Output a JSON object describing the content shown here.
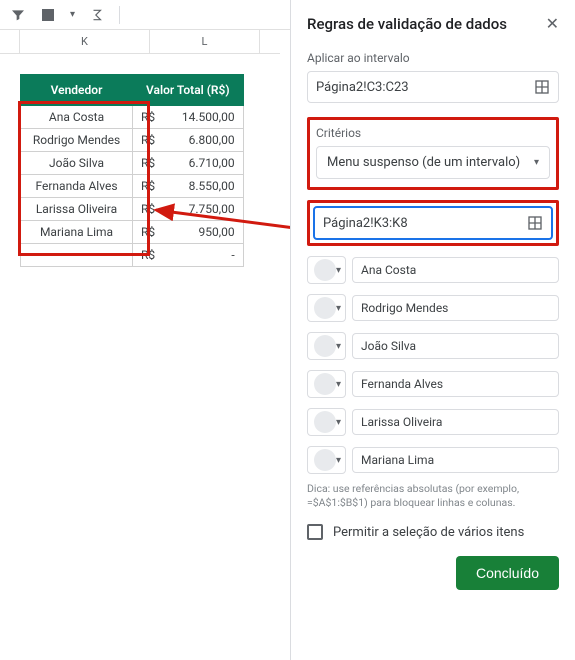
{
  "toolbar": {
    "col_k": "K",
    "col_l": "L"
  },
  "table": {
    "headers": {
      "vendedor": "Vendedor",
      "valor": "Valor Total (R$)"
    },
    "rows": [
      {
        "name": "Ana Costa",
        "curr": "R$",
        "val": "14.500,00"
      },
      {
        "name": "Rodrigo Mendes",
        "curr": "R$",
        "val": "6.800,00"
      },
      {
        "name": "João Silva",
        "curr": "R$",
        "val": "6.710,00"
      },
      {
        "name": "Fernanda Alves",
        "curr": "R$",
        "val": "8.550,00"
      },
      {
        "name": "Larissa Oliveira",
        "curr": "R$",
        "val": "7.750,00"
      },
      {
        "name": "Mariana Lima",
        "curr": "R$",
        "val": "950,00"
      }
    ],
    "empty": {
      "curr": "R$",
      "val": "-"
    }
  },
  "panel": {
    "title": "Regras de validação de dados",
    "apply_label": "Aplicar ao intervalo",
    "apply_range": "Página2!C3:C23",
    "criteria_label": "Critérios",
    "criteria_type": "Menu suspenso (de um intervalo)",
    "source_range": "Página2!K3:K8",
    "options": [
      "Ana Costa",
      "Rodrigo Mendes",
      "João Silva",
      "Fernanda Alves",
      "Larissa Oliveira",
      "Mariana Lima"
    ],
    "hint": "Dica: use referências absolutas (por exemplo, =$A$1:$B$1) para bloquear linhas e colunas.",
    "multi_label": "Permitir a seleção de vários itens",
    "done": "Concluído"
  }
}
